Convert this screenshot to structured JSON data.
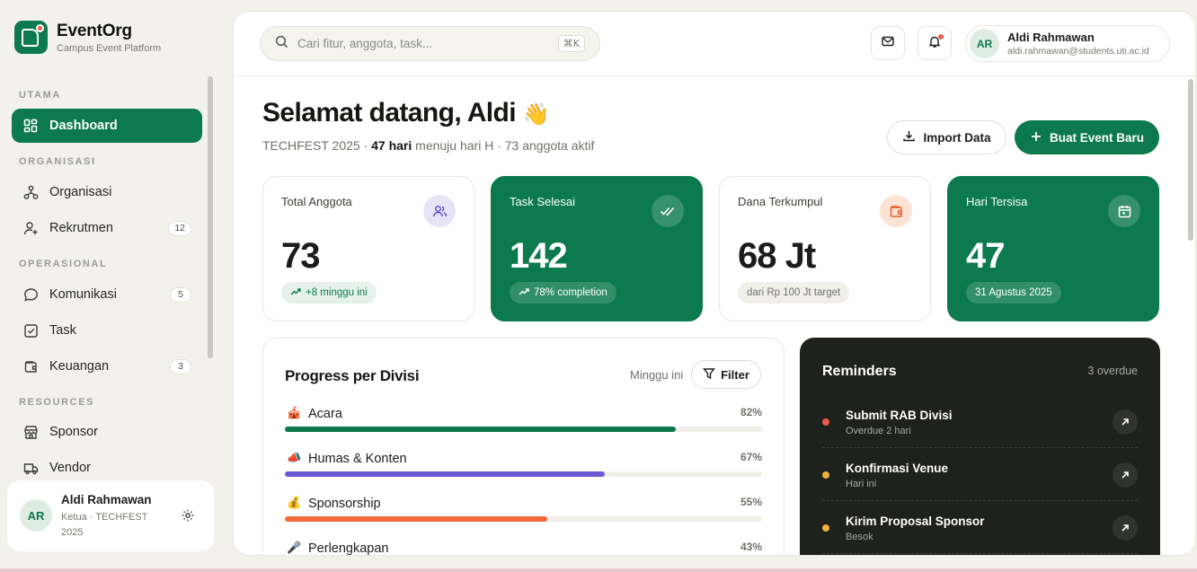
{
  "brand": {
    "name": "EventOrg",
    "subtitle": "Campus Event Platform"
  },
  "sidebar": {
    "sections": [
      {
        "label": "UTAMA"
      },
      {
        "label": "ORGANISASI"
      },
      {
        "label": "OPERASIONAL"
      },
      {
        "label": "RESOURCES"
      }
    ],
    "items": [
      {
        "label": "Dashboard",
        "icon": "dashboard-icon",
        "active": true
      },
      {
        "label": "Organisasi",
        "icon": "org-chart-icon"
      },
      {
        "label": "Rekrutmen",
        "icon": "user-plus-icon",
        "badge": "12"
      },
      {
        "label": "Komunikasi",
        "icon": "chat-icon",
        "badge": "5"
      },
      {
        "label": "Task",
        "icon": "checkbox-icon"
      },
      {
        "label": "Keuangan",
        "icon": "wallet-icon",
        "badge": "3"
      },
      {
        "label": "Sponsor",
        "icon": "store-icon"
      },
      {
        "label": "Vendor",
        "icon": "truck-icon"
      }
    ],
    "user": {
      "initials": "AR",
      "name": "Aldi Rahmawan",
      "role": "Ketua · TECHFEST 2025"
    }
  },
  "topbar": {
    "search_placeholder": "Cari fitur, anggota, task...",
    "search_shortcut": "⌘K",
    "profile": {
      "initials": "AR",
      "name": "Aldi Rahmawan",
      "email": "aldi.rahmawan@students.uti.ac.id"
    }
  },
  "header": {
    "greeting": "Selamat datang, Aldi",
    "wave_emoji": "👋",
    "sub_event": "TECHFEST 2025 · ",
    "sub_days": "47 hari",
    "sub_rest": " menuju hari H · 73 anggota aktif",
    "import_label": "Import Data",
    "create_label": "Buat Event Baru"
  },
  "stats": [
    {
      "label": "Total Anggota",
      "value": "73",
      "chip": "+8 minggu ini",
      "icon": "users-icon"
    },
    {
      "label": "Task Selesai",
      "value": "142",
      "chip": "78% completion",
      "icon": "double-check-icon"
    },
    {
      "label": "Dana Terkumpul",
      "value": "68 Jt",
      "chip": "dari Rp 100 Jt target",
      "icon": "wallet-icon"
    },
    {
      "label": "Hari Tersisa",
      "value": "47",
      "chip": "31 Agustus 2025",
      "icon": "calendar-icon"
    }
  ],
  "progress": {
    "title": "Progress per Divisi",
    "range": "Minggu ini",
    "filter_label": "Filter",
    "rows": [
      {
        "emoji": "🎪",
        "name": "Acara",
        "percent_label": "82%",
        "value": 82,
        "color": "#0c7a4c"
      },
      {
        "emoji": "📣",
        "name": "Humas & Konten",
        "percent_label": "67%",
        "value": 67,
        "color": "#6a5ad6"
      },
      {
        "emoji": "💰",
        "name": "Sponsorship",
        "percent_label": "55%",
        "value": 55,
        "color": "#f36b3b"
      },
      {
        "emoji": "🎤",
        "name": "Perlengkapan",
        "percent_label": "43%",
        "value": 43,
        "color": "#e9b33a"
      }
    ]
  },
  "reminders": {
    "title": "Reminders",
    "count": "3 overdue",
    "items": [
      {
        "title": "Submit RAB Divisi",
        "sub": "Overdue 2 hari",
        "dot": "#f25a4a"
      },
      {
        "title": "Konfirmasi Venue",
        "sub": "Hari ini",
        "dot": "#f2b33a"
      },
      {
        "title": "Kirim Proposal Sponsor",
        "sub": "Besok",
        "dot": "#f2b33a"
      }
    ]
  },
  "colors": {
    "accent": "#0c7a4c",
    "dark": "#1f211d",
    "bg": "#f3f1eb"
  }
}
